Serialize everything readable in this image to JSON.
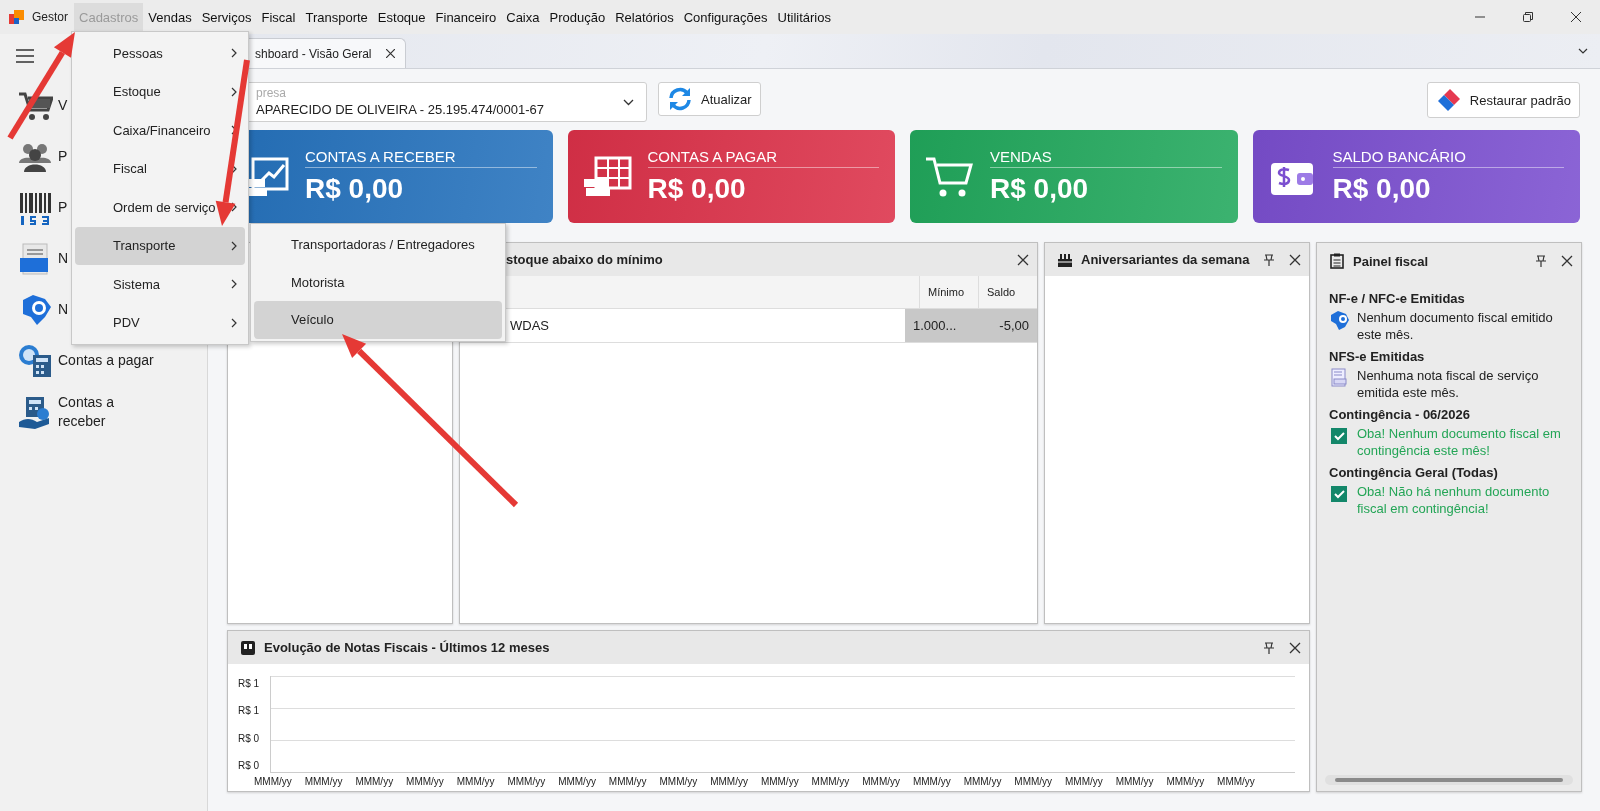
{
  "menubar": {
    "app": "Gestor",
    "items": [
      {
        "label": "Cadastros",
        "selected": true
      },
      {
        "label": "Vendas",
        "selected": false
      },
      {
        "label": "Serviços",
        "selected": false
      },
      {
        "label": "Fiscal",
        "selected": false
      },
      {
        "label": "Transporte",
        "selected": false
      },
      {
        "label": "Estoque",
        "selected": false
      },
      {
        "label": "Financeiro",
        "selected": false
      },
      {
        "label": "Caixa",
        "selected": false
      },
      {
        "label": "Produção",
        "selected": false
      },
      {
        "label": "Relatórios",
        "selected": false
      },
      {
        "label": "Configurações",
        "selected": false
      },
      {
        "label": "Utilitários",
        "selected": false
      }
    ]
  },
  "sidebar": {
    "items": [
      {
        "label": "V",
        "kind": "cart"
      },
      {
        "label": "P",
        "kind": "people"
      },
      {
        "label": "P",
        "kind": "barcode"
      },
      {
        "label": "N",
        "kind": "nfse"
      },
      {
        "label": "N",
        "kind": "nfe"
      },
      {
        "label": "Contas a pagar",
        "kind": "payable"
      },
      {
        "label": "Contas a receber",
        "kind": "receivable"
      }
    ]
  },
  "tabs": [
    {
      "label": "shboard - Visão Geral",
      "selected": true
    }
  ],
  "company_field": {
    "label": "presa",
    "value": "APARECIDO DE OLIVEIRA - 25.195.474/0001-67"
  },
  "refresh_button": "Atualizar",
  "reset_button": "Restaurar padrão",
  "cards": [
    {
      "title": "CONTAS A RECEBER",
      "value": "R$ 0,00",
      "color": "#2572bd",
      "kind": "receivable"
    },
    {
      "title": "CONTAS A PAGAR",
      "value": "R$ 0,00",
      "color": "#dc3149",
      "kind": "payable"
    },
    {
      "title": "VENDAS",
      "value": "R$ 0,00",
      "color": "#21a85c",
      "kind": "sales"
    },
    {
      "title": "SALDO BANCÁRIO",
      "value": "R$ 0,00",
      "color": "#7b4fd0",
      "kind": "bank"
    }
  ],
  "stock_panel": {
    "title": "stoque abaixo do mínimo",
    "columns": [
      "",
      "Mínimo",
      "Saldo"
    ],
    "rows": [
      {
        "cells": [
          "WDAS",
          "1.000...",
          "-5,00"
        ],
        "selected": true
      }
    ]
  },
  "birthday_panel": {
    "title": "Aniversariantes da semana"
  },
  "fiscal_panel": {
    "title": "Painel fiscal",
    "sections": [
      {
        "heading": "NF-e / NFC-e Emitidas",
        "kind": "nfe",
        "message": "Nenhum documento fiscal emitido este mês."
      },
      {
        "heading": "NFS-e Emitidas",
        "kind": "nfse",
        "message": "Nenhuma nota fiscal de serviço emitida este mês."
      },
      {
        "heading": "Contingência - 06/2026",
        "kind": "ok",
        "message": "Oba! Nenhum documento fiscal em contingência este mês!"
      },
      {
        "heading": "Contingência Geral (Todas)",
        "kind": "ok",
        "message": "Oba! Não há nenhum documento fiscal em contingência!"
      }
    ]
  },
  "chart_panel": {
    "title": "Evolução de Notas Fiscais - Últimos 12 meses",
    "y_labels": [
      "R$ 1",
      "R$ 1",
      "R$ 0",
      "R$ 0"
    ],
    "x_labels": [
      "MMM/yy",
      "MMM/yy",
      "MMM/yy",
      "MMM/yy",
      "MMM/yy",
      "MMM/yy",
      "MMM/yy",
      "MMM/yy",
      "MMM/yy",
      "MMM/yy",
      "MMM/yy",
      "MMM/yy",
      "MMM/yy",
      "MMM/yy",
      "MMM/yy",
      "MMM/yy",
      "MMM/yy",
      "MMM/yy",
      "MMM/yy",
      "MMM/yy"
    ]
  },
  "menu": {
    "items": [
      {
        "label": "Pessoas",
        "selected": false
      },
      {
        "label": "Estoque",
        "selected": false
      },
      {
        "label": "Caixa/Financeiro",
        "selected": false
      },
      {
        "label": "Fiscal",
        "selected": false
      },
      {
        "label": "Ordem de serviço",
        "selected": false
      },
      {
        "label": "Transporte",
        "selected": true
      },
      {
        "label": "Sistema",
        "selected": false
      },
      {
        "label": "PDV",
        "selected": false
      }
    ]
  },
  "submenu": {
    "items": [
      {
        "label": "Transportadoras / Entregadores",
        "selected": false
      },
      {
        "label": "Motorista",
        "selected": false
      },
      {
        "label": "Veículo",
        "selected": true
      }
    ]
  }
}
